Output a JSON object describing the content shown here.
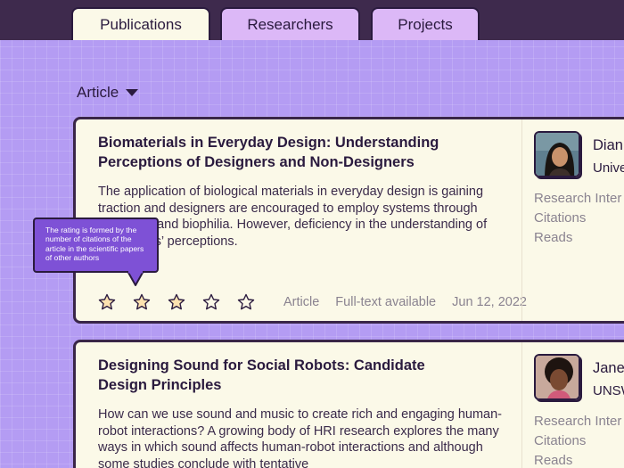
{
  "tabs": [
    {
      "label": "Publications",
      "active": true
    },
    {
      "label": "Researchers",
      "active": false
    },
    {
      "label": "Projects",
      "active": false
    }
  ],
  "filter": {
    "label": "Article",
    "icon": "caret-down-icon"
  },
  "tooltip": {
    "text": "The rating is formed by the number of citations of the article in the scientific papers of other authors"
  },
  "publications": [
    {
      "title": "Biomaterials in Everyday Design: Understanding Perceptions of Designers and Non-Designers",
      "abstract": "The application of biological materials in everyday design is gaining traction and designers are encouraged to employ systems through biodesign and biophilia. However, deficiency in the understanding of potential rs’ perceptions.",
      "rating": 3,
      "rating_max": 5,
      "type": "Article",
      "availability": "Full-text available",
      "date": "Jun 12, 2022",
      "author": {
        "name": "Dian",
        "affiliation": "Unive",
        "stats": [
          "Research Inter",
          "Citations",
          "Reads"
        ]
      }
    },
    {
      "title": "Designing Sound for Social Robots: Candidate Design Principles",
      "abstract": "How can we use sound and music to create rich and engaging human-robot interactions? A growing body of HRI research explores the many ways in which sound affects human-robot interactions and although some studies conclude with tentative",
      "author": {
        "name": "Jane",
        "affiliation": "UNSW",
        "stats": [
          "Research Inter",
          "Citations",
          "Reads"
        ]
      }
    }
  ],
  "colors": {
    "background": "#b49cf3",
    "topbar": "#3e2a4d",
    "card": "#fbf9e8",
    "tab_inactive": "#dcb8f7",
    "tooltip": "#7e51d6",
    "star_filled": "#fde2b0",
    "muted_text": "#8a8390"
  }
}
